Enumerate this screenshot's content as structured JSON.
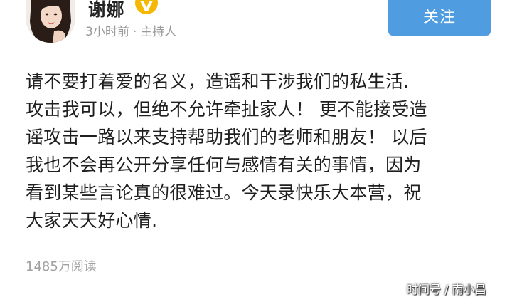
{
  "post": {
    "author": {
      "name": "谢娜",
      "avatar_icon": "user-avatar-photo",
      "verified_icon": "verified-v-badge-icon",
      "verified_color": "#f5b800"
    },
    "meta": {
      "time": "3小时前",
      "separator": "·",
      "source": "主持人"
    },
    "follow_button": {
      "label": "关注",
      "color": "#4f9ce0"
    },
    "content_lines": [
      "请不要打着爱的名义，造谣和干涉我们的私生活.",
      "攻击我可以，但绝不允许牵扯家人！ 更不能接受造",
      "谣攻击一路以来支持帮助我们的老师和朋友！ 以后",
      "我也不会再公开分享任何与感情有关的事情，因为",
      "看到某些言论真的很难过。今天录快乐大本营，祝",
      "大家天天好心情."
    ],
    "read_count": "1485万阅读"
  },
  "watermark": "时间号 / 南小昌"
}
